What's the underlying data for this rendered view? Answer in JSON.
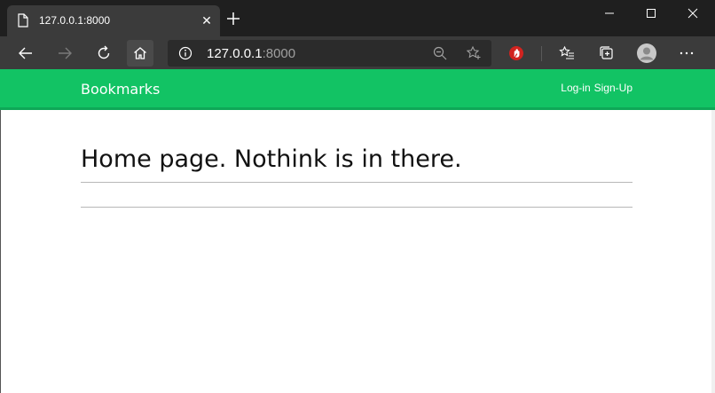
{
  "browser": {
    "tab_title": "127.0.0.1:8000",
    "close_glyph": "✕",
    "address": {
      "host": "127.0.0.1",
      "port": ":8000"
    }
  },
  "navbar": {
    "brand": "Bookmarks",
    "login": "Log-in",
    "signup": "Sign-Up",
    "color": "#12c364"
  },
  "page": {
    "heading": "Home page. Nothink is in there."
  }
}
